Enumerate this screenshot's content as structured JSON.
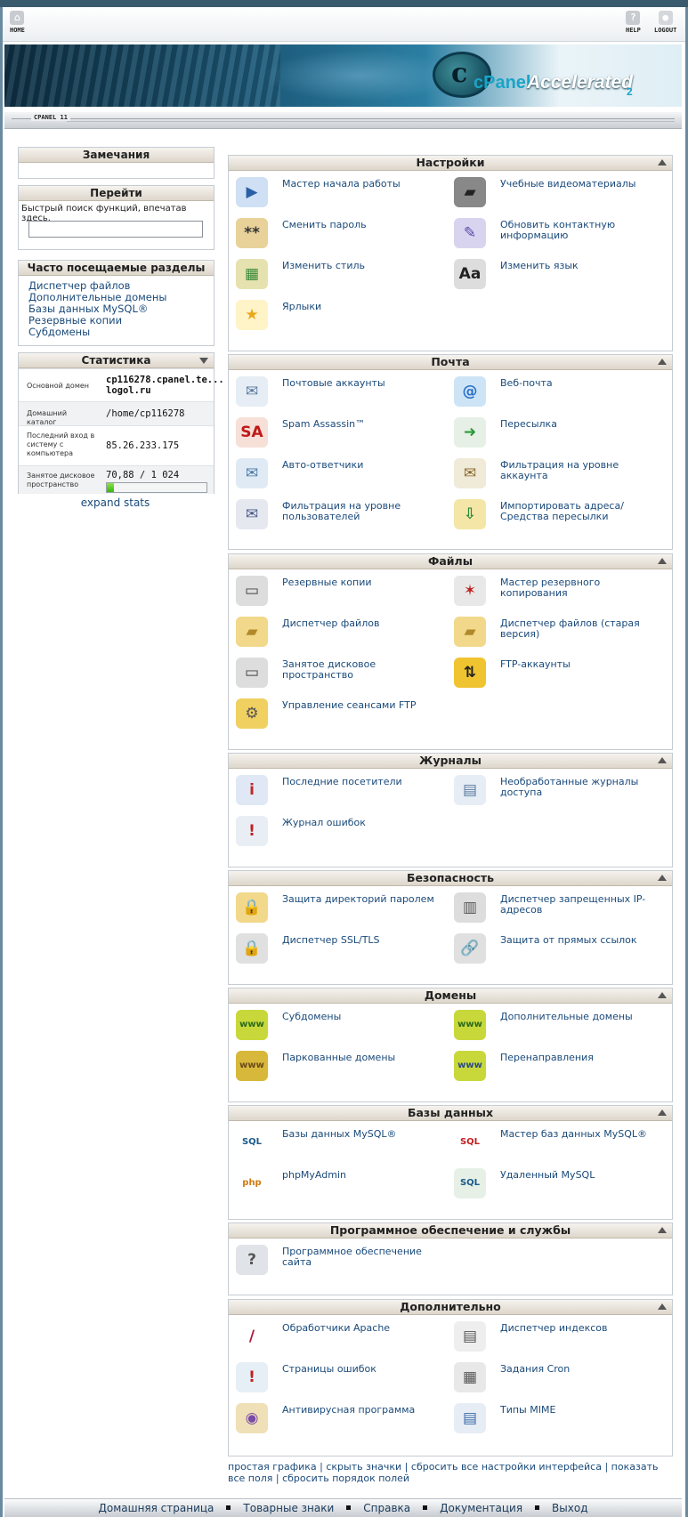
{
  "topnav": {
    "home": "HOME",
    "help": "HELP",
    "logout": "LOGOUT"
  },
  "banner": {
    "logo_cpanel": "cPanel",
    "logo_accelerated": "Accelerated",
    "logo_version": "2"
  },
  "brand_bar": {
    "label": "CPANEL 11"
  },
  "notes": {
    "title": "Замечания"
  },
  "goto": {
    "title": "Перейти",
    "hint": "Быстрый поиск функций, впечатав здесь.",
    "placeholder": ""
  },
  "frequent": {
    "title": "Часто посещаемые разделы",
    "links": [
      "Диспетчер файлов",
      "Дополнительные домены",
      "Базы данных MySQL®",
      "Резервные копии",
      "Субдомены"
    ]
  },
  "stats": {
    "title": "Статистика",
    "rows": [
      {
        "key": "Основной домен",
        "value": "cp116278.cpanel.te... logol.ru"
      },
      {
        "key": "Домашний каталог",
        "value": "/home/cp116278"
      },
      {
        "key": "Последний вход в систему с компьютера",
        "value": "85.26.233.175"
      },
      {
        "key": "Занятое дисковое пространство",
        "value": "70,88 / 1 024"
      }
    ],
    "disk_used_fraction": 0.069,
    "expand": "expand stats"
  },
  "sections": [
    {
      "title": "Настройки",
      "items": [
        {
          "label": "Мастер начала работы",
          "icon": "play-icon"
        },
        {
          "label": "Учебные видеоматериалы",
          "icon": "clapperboard-icon"
        },
        {
          "label": "Сменить пароль",
          "icon": "password-icon"
        },
        {
          "label": "Обновить контактную информацию",
          "icon": "contact-icon"
        },
        {
          "label": "Изменить стиль",
          "icon": "style-icon"
        },
        {
          "label": "Изменить язык",
          "icon": "language-icon"
        },
        {
          "label": "Ярлыки",
          "icon": "star-icon"
        }
      ]
    },
    {
      "title": "Почта",
      "items": [
        {
          "label": "Почтовые аккаунты",
          "icon": "envelope-icon"
        },
        {
          "label": "Веб-почта",
          "icon": "webmail-icon"
        },
        {
          "label": "Spam Assassin™",
          "icon": "spamassassin-icon"
        },
        {
          "label": "Пересылка",
          "icon": "forward-icon"
        },
        {
          "label": "Авто-ответчики",
          "icon": "autoresponder-icon"
        },
        {
          "label": "Фильтрация на уровне аккаунта",
          "icon": "filter-icon"
        },
        {
          "label": "Фильтрация на уровне пользователей",
          "icon": "user-filter-icon"
        },
        {
          "label": "Импортировать адреса/ Средства пересылки",
          "icon": "import-icon"
        }
      ]
    },
    {
      "title": "Файлы",
      "items": [
        {
          "label": "Резервные копии",
          "icon": "backup-icon"
        },
        {
          "label": "Мастер резервного копирования",
          "icon": "backup-wizard-icon"
        },
        {
          "label": "Диспетчер файлов",
          "icon": "folder-icon"
        },
        {
          "label": "Диспетчер файлов (старая версия)",
          "icon": "folder-legacy-icon"
        },
        {
          "label": "Занятое дисковое пространство",
          "icon": "disk-icon"
        },
        {
          "label": "FTP-аккаунты",
          "icon": "ftp-icon"
        },
        {
          "label": "Управление сеансами FTP",
          "icon": "ftp-session-icon"
        }
      ]
    },
    {
      "title": "Журналы",
      "items": [
        {
          "label": "Последние посетители",
          "icon": "visitors-icon"
        },
        {
          "label": "Необработанные журналы доступа",
          "icon": "raw-log-icon"
        },
        {
          "label": "Журнал ошибок",
          "icon": "error-log-icon"
        }
      ]
    },
    {
      "title": "Безопасность",
      "items": [
        {
          "label": "Защита директорий паролем",
          "icon": "lock-folder-icon"
        },
        {
          "label": "Диспетчер запрещенных IP-адресов",
          "icon": "ip-deny-icon"
        },
        {
          "label": "Диспетчер SSL/TLS",
          "icon": "ssl-icon"
        },
        {
          "label": "Защита от прямых ссылок",
          "icon": "hotlink-icon"
        }
      ]
    },
    {
      "title": "Домены",
      "items": [
        {
          "label": "Субдомены",
          "icon": "subdomain-icon"
        },
        {
          "label": "Дополнительные домены",
          "icon": "addon-domain-icon"
        },
        {
          "label": "Паркованные домены",
          "icon": "parked-domain-icon"
        },
        {
          "label": "Перенаправления",
          "icon": "redirect-icon"
        }
      ]
    },
    {
      "title": "Базы данных",
      "items": [
        {
          "label": "Базы данных MySQL®",
          "icon": "mysql-icon"
        },
        {
          "label": "Мастер баз данных MySQL®",
          "icon": "mysql-wizard-icon"
        },
        {
          "label": "phpMyAdmin",
          "icon": "phpmyadmin-icon"
        },
        {
          "label": "Удаленный MySQL",
          "icon": "remote-mysql-icon"
        }
      ]
    },
    {
      "title": "Программное обеспечение и службы",
      "items": [
        {
          "label": "Программное обеспечение сайта",
          "icon": "software-icon"
        }
      ]
    },
    {
      "title": "Дополнительно",
      "items": [
        {
          "label": "Обработчики Apache",
          "icon": "apache-feather-icon"
        },
        {
          "label": "Диспетчер индексов",
          "icon": "index-icon"
        },
        {
          "label": "Страницы ошибок",
          "icon": "error-page-icon"
        },
        {
          "label": "Задания Cron",
          "icon": "cron-icon"
        },
        {
          "label": "Антивирусная программа",
          "icon": "antivirus-icon"
        },
        {
          "label": "Типы MIME",
          "icon": "mime-icon"
        }
      ]
    }
  ],
  "footer_links": [
    "простая графика",
    "скрыть значки",
    "сбросить все настройки интерфейса",
    "показать все поля",
    "сбросить порядок полей"
  ],
  "footer_nav": [
    "Домашняя страница",
    "Товарные знаки",
    "Справка",
    "Документация",
    "Выход"
  ],
  "colors": {
    "link": "#1a4a7a",
    "header_bg": "#ddd6cb",
    "progress": "#38b70f"
  }
}
